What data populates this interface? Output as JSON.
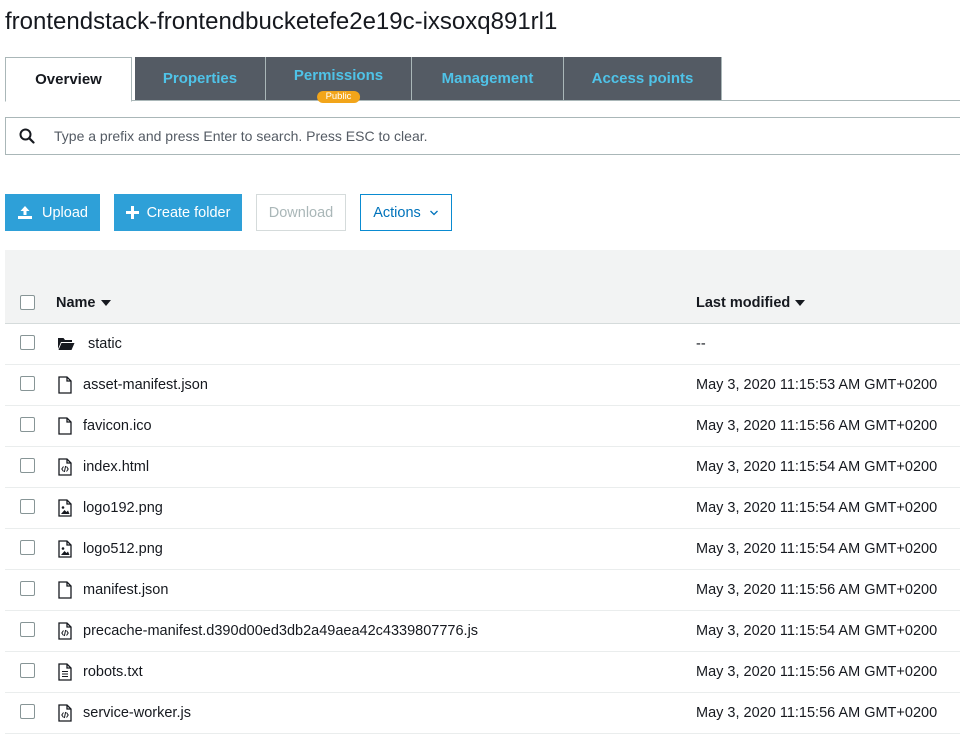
{
  "bucket": {
    "title": "frontendstack-frontendbucketefe2e19c-ixsoxq891rl1"
  },
  "tabs": [
    {
      "label": "Overview"
    },
    {
      "label": "Properties"
    },
    {
      "label": "Permissions",
      "badge": "Public"
    },
    {
      "label": "Management"
    },
    {
      "label": "Access points"
    }
  ],
  "search": {
    "placeholder": "Type a prefix and press Enter to search. Press ESC to clear."
  },
  "toolbar": {
    "upload": "Upload",
    "create_folder": "Create folder",
    "download": "Download",
    "actions": "Actions"
  },
  "table": {
    "headers": {
      "name": "Name",
      "last_modified": "Last modified"
    },
    "rows": [
      {
        "name": "static",
        "modified": "--",
        "icon": "folder-icon"
      },
      {
        "name": "asset-manifest.json",
        "modified": "May 3, 2020 11:15:53 AM GMT+0200",
        "icon": "file-icon"
      },
      {
        "name": "favicon.ico",
        "modified": "May 3, 2020 11:15:56 AM GMT+0200",
        "icon": "file-icon"
      },
      {
        "name": "index.html",
        "modified": "May 3, 2020 11:15:54 AM GMT+0200",
        "icon": "code-file-icon"
      },
      {
        "name": "logo192.png",
        "modified": "May 3, 2020 11:15:54 AM GMT+0200",
        "icon": "image-file-icon"
      },
      {
        "name": "logo512.png",
        "modified": "May 3, 2020 11:15:54 AM GMT+0200",
        "icon": "image-file-icon"
      },
      {
        "name": "manifest.json",
        "modified": "May 3, 2020 11:15:56 AM GMT+0200",
        "icon": "file-icon"
      },
      {
        "name": "precache-manifest.d390d00ed3db2a49aea42c4339807776.js",
        "modified": "May 3, 2020 11:15:54 AM GMT+0200",
        "icon": "code-file-icon"
      },
      {
        "name": "robots.txt",
        "modified": "May 3, 2020 11:15:56 AM GMT+0200",
        "icon": "text-file-icon"
      },
      {
        "name": "service-worker.js",
        "modified": "May 3, 2020 11:15:56 AM GMT+0200",
        "icon": "code-file-icon"
      }
    ]
  },
  "colors": {
    "tab_bg": "#545b64",
    "tab_text": "#4fc3e8",
    "primary_button": "#2ea0d8",
    "badge": "#f2a51a",
    "link": "#0073bb"
  }
}
